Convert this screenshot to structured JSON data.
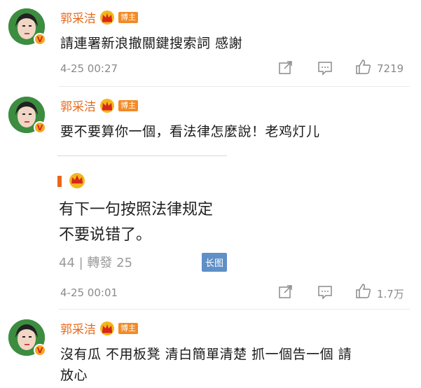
{
  "comments": [
    {
      "name": "郭采洁",
      "badge": "博主",
      "text": "請連署新浪撤關鍵搜索詞  感謝",
      "time": "4-25 00:27",
      "likes": "7219"
    },
    {
      "name": "郭采洁",
      "badge": "博主",
      "text": "要不要算你一個，看法律怎麼說！老鸡灯儿",
      "quote": {
        "line1": "有下一句按照法律规定",
        "line2": "不要说错了。",
        "stats": "44 | 轉發 25",
        "long_image_label": "长图"
      },
      "time": "4-25 00:01",
      "likes": "1.7万"
    },
    {
      "name": "郭采洁",
      "badge": "博主",
      "text_line1": "沒有瓜 不用板凳 清白簡單清楚 抓一個告一個 請",
      "text_line2": "放心"
    }
  ],
  "colors": {
    "name": "#e8681a",
    "badge_bg": "#f28b26",
    "meta": "#8a8a8a",
    "long_image_bg": "#5f8fc7"
  },
  "icons": [
    "avatar",
    "verified-v-icon",
    "crown-icon",
    "share-icon",
    "comment-icon",
    "like-icon"
  ]
}
